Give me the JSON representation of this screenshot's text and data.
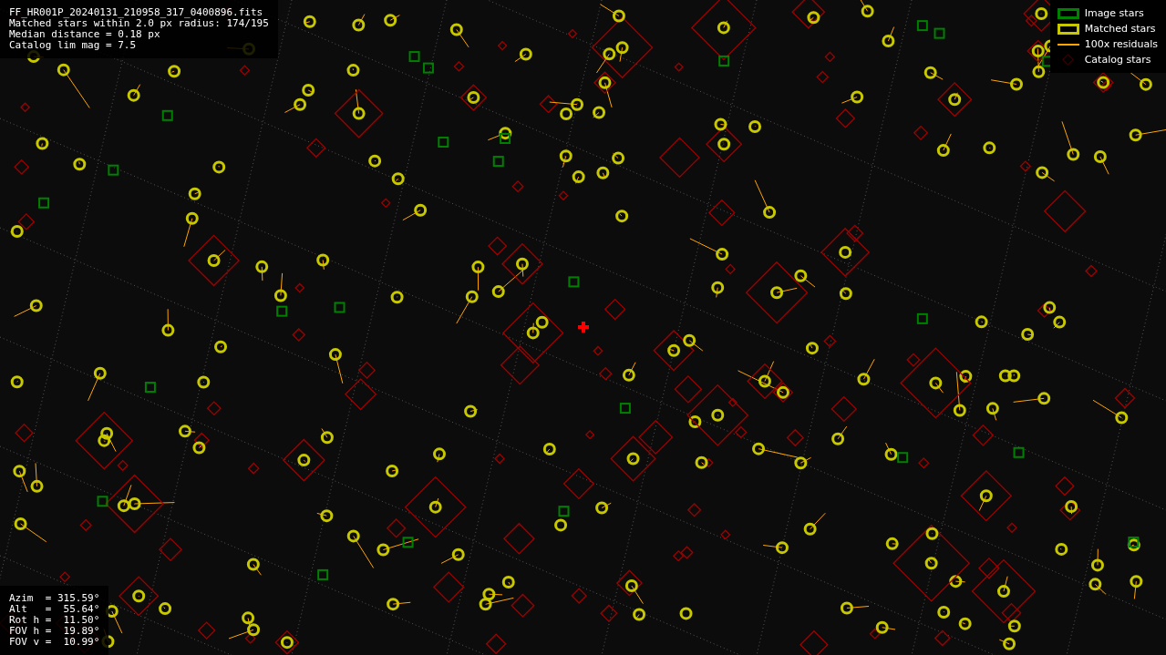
{
  "file_info": {
    "lines": [
      "FF_HR001P_20240131_210958_317_0400896.fits",
      "Matched stars within 2.0 px radius: 174/195",
      "Median distance = 0.18 px",
      "Catalog lim mag = 7.5"
    ]
  },
  "legend": [
    {
      "kind": "box",
      "label": "Image stars",
      "color": "#008000"
    },
    {
      "kind": "box",
      "label": "Matched stars",
      "color": "#c8c800"
    },
    {
      "kind": "line",
      "label": "100x residuals",
      "color": "#ffa500"
    },
    {
      "kind": "diamond",
      "label": "Catalog stars",
      "color": "#400000"
    }
  ],
  "pointing": {
    "lines": [
      "Azim  = 315.59°",
      "Alt   =  55.64°",
      "Rot h =  11.50°",
      "FOV h =  19.89°",
      "FOV v =  10.99°"
    ]
  }
}
